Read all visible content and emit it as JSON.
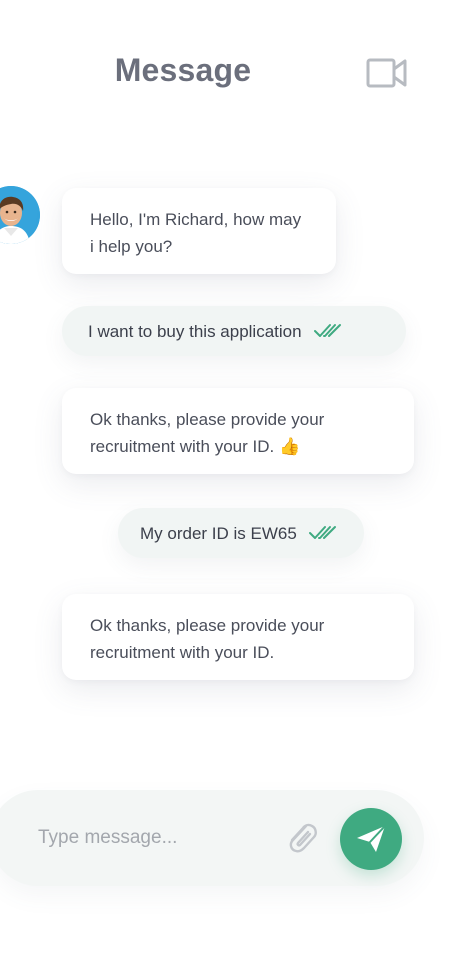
{
  "header": {
    "title": "Message",
    "video_icon": "video-camera-icon"
  },
  "contact": {
    "avatar_icon": "avatar"
  },
  "messages": [
    {
      "direction": "incoming",
      "text": "Hello, I'm Richard, how may i help you?"
    },
    {
      "direction": "outgoing",
      "text": "I want to buy this application",
      "status": "read"
    },
    {
      "direction": "incoming",
      "text": "Ok thanks, please provide your recruitment with your ID. 👍"
    },
    {
      "direction": "outgoing",
      "text": "My order ID is EW65",
      "status": "read"
    },
    {
      "direction": "incoming",
      "text": "Ok thanks, please provide your recruitment with your ID."
    }
  ],
  "composer": {
    "placeholder": "Type message...",
    "attach_icon": "paperclip-icon",
    "send_icon": "send-icon"
  },
  "colors": {
    "accent": "#3faa81",
    "title": "#6b6f7c",
    "outgoing_bg": "#f1f5f4",
    "incoming_bg": "#ffffff"
  }
}
